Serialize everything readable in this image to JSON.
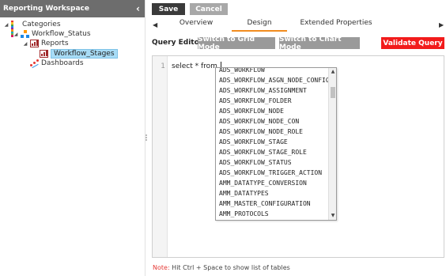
{
  "sidebar": {
    "title": "Reporting Workspace",
    "tree": [
      {
        "label": "Categories",
        "expander": "◢",
        "icon": "categories-grid-icon"
      },
      {
        "label": "Workflow_Status",
        "expander": "◢",
        "icon": "workflow-icon"
      },
      {
        "label": "Reports",
        "expander": "◢",
        "icon": "report-chart-icon"
      },
      {
        "label": "Workflow_Stages",
        "expander": "",
        "icon": "report-chart-icon",
        "selected": true
      },
      {
        "label": "Dashboards",
        "expander": "",
        "icon": "dashboard-icon"
      }
    ]
  },
  "toolbar": {
    "save_label": "Save",
    "cancel_label": "Cancel"
  },
  "tabs": [
    {
      "label": "Overview",
      "active": false
    },
    {
      "label": "Design",
      "active": true
    },
    {
      "label": "Extended Properties",
      "active": false
    }
  ],
  "query_editor": {
    "label": "Query Editor",
    "grid_mode_label": "Switch to Grid Mode",
    "chart_mode_label": "Switch to Chart Mode",
    "validate_label": "Validate Query",
    "line_number": "1",
    "query_text": "select * from "
  },
  "autocomplete": {
    "items": [
      "ADS_WORKFLOW",
      "ADS_WORKFLOW_ASGN_NODE_CONFIG",
      "ADS_WORKFLOW_ASSIGNMENT",
      "ADS_WORKFLOW_FOLDER",
      "ADS_WORKFLOW_NODE",
      "ADS_WORKFLOW_NODE_CON",
      "ADS_WORKFLOW_NODE_ROLE",
      "ADS_WORKFLOW_STAGE",
      "ADS_WORKFLOW_STAGE_ROLE",
      "ADS_WORKFLOW_STATUS",
      "ADS_WORKFLOW_TRIGGER_ACTION",
      "AMM_DATATYPE_CONVERSION",
      "AMM_DATATYPES",
      "AMM_MASTER_CONFIGURATION",
      "AMM_PROTOCOLS"
    ]
  },
  "note": {
    "key": "Note:",
    "text": " Hit Ctrl + Space to show list of tables"
  },
  "colors": {
    "header_bg": "#6d6d6d",
    "active_tab": "#f28c1f",
    "validate_bg": "#f21b1b",
    "selected_node": "#a8dcf6"
  }
}
